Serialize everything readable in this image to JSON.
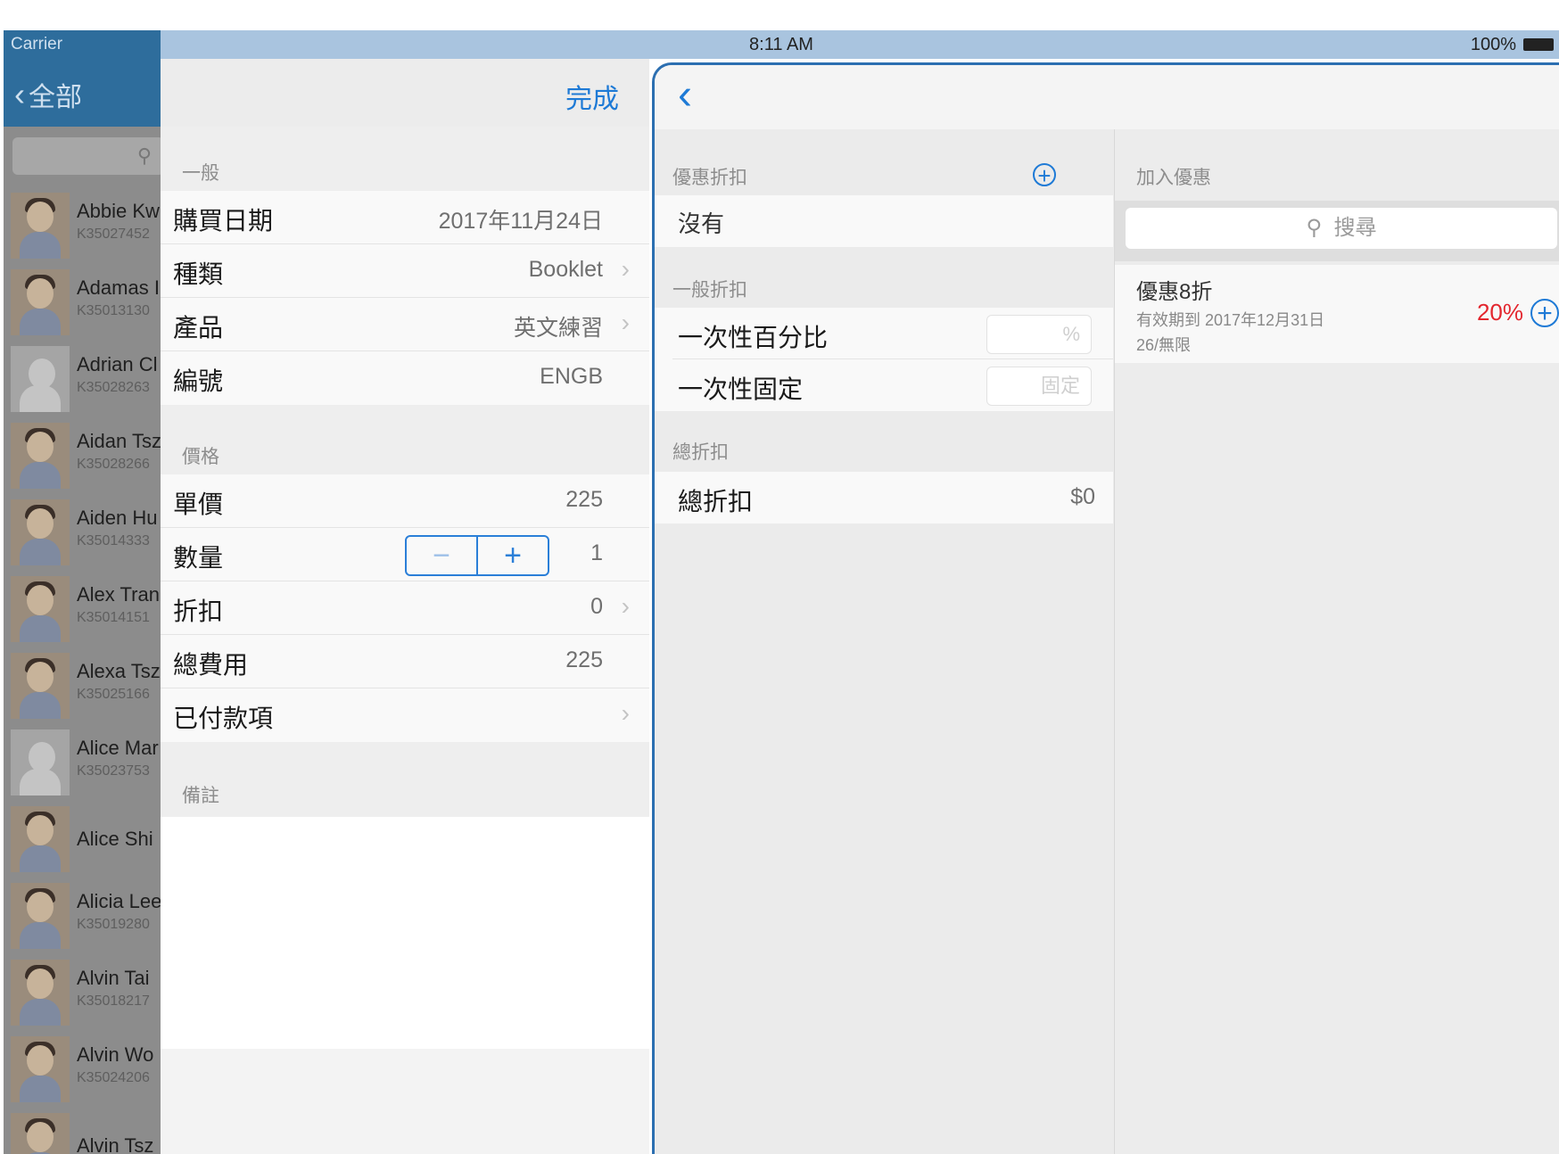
{
  "status_bar": {
    "carrier": "Carrier",
    "time": "8:11 AM",
    "battery": "100%"
  },
  "contacts": {
    "back_label": "全部",
    "items": [
      {
        "name": "Abbie Kw",
        "code": "K35027452",
        "avatar": "photo"
      },
      {
        "name": "Adamas I",
        "code": "K35013130",
        "avatar": "photo"
      },
      {
        "name": "Adrian Cl",
        "code": "K35028263",
        "avatar": "silhouette"
      },
      {
        "name": "Aidan Tsz",
        "code": "K35028266",
        "avatar": "photo"
      },
      {
        "name": "Aiden Hu",
        "code": "K35014333",
        "avatar": "photo"
      },
      {
        "name": "Alex Tran",
        "code": "K35014151",
        "avatar": "photo"
      },
      {
        "name": "Alexa Tsz",
        "code": "K35025166",
        "avatar": "photo"
      },
      {
        "name": "Alice Mar",
        "code": "K35023753",
        "avatar": "silhouette"
      },
      {
        "name": "Alice Shi",
        "code": "",
        "avatar": "photo"
      },
      {
        "name": "Alicia Lee",
        "code": "K35019280",
        "avatar": "photo"
      },
      {
        "name": "Alvin Tai",
        "code": "K35018217",
        "avatar": "photo"
      },
      {
        "name": "Alvin Wo",
        "code": "K35024206",
        "avatar": "photo"
      },
      {
        "name": "Alvin Tsz",
        "code": "",
        "avatar": "photo"
      }
    ]
  },
  "details": {
    "done_label": "完成",
    "general_title": "一般",
    "general_rows": [
      {
        "label": "購買日期",
        "value": "2017年11月24日",
        "chevron": false
      },
      {
        "label": "種類",
        "value": "Booklet",
        "chevron": true
      },
      {
        "label": "產品",
        "value": "英文練習",
        "chevron": true
      },
      {
        "label": "編號",
        "value": "ENGB",
        "chevron": false
      }
    ],
    "price_title": "價格",
    "price_rows": [
      {
        "label": "單價",
        "value": "225",
        "chevron": false
      },
      {
        "label": "數量",
        "value": "1",
        "chevron": false
      },
      {
        "label": "折扣",
        "value": "0",
        "chevron": true
      },
      {
        "label": "總費用",
        "value": "225",
        "chevron": false
      },
      {
        "label": "已付款項",
        "value": "",
        "chevron": true
      }
    ],
    "notes_title": "備註",
    "stepper": {
      "minus": "−",
      "plus": "+"
    }
  },
  "discount": {
    "promo_title": "優惠折扣",
    "promo_none": "沒有",
    "general_title": "一般折扣",
    "percent_label": "一次性百分比",
    "percent_placeholder": "%",
    "fixed_label": "一次性固定",
    "fixed_placeholder": "固定",
    "total_title": "總折扣",
    "total_label": "總折扣",
    "total_value": "$0",
    "add_title": "加入優惠",
    "search_placeholder": "搜尋",
    "promo_item": {
      "title": "優惠8折",
      "validity": "有效期到 2017年12月31日",
      "quota": "26/無限",
      "percent": "20%"
    }
  },
  "colors": {
    "accent": "#1e7ad6",
    "nav_dark": "#2e6d9c",
    "status_bar": "#a9c4df",
    "promo_red": "#e3262e"
  }
}
